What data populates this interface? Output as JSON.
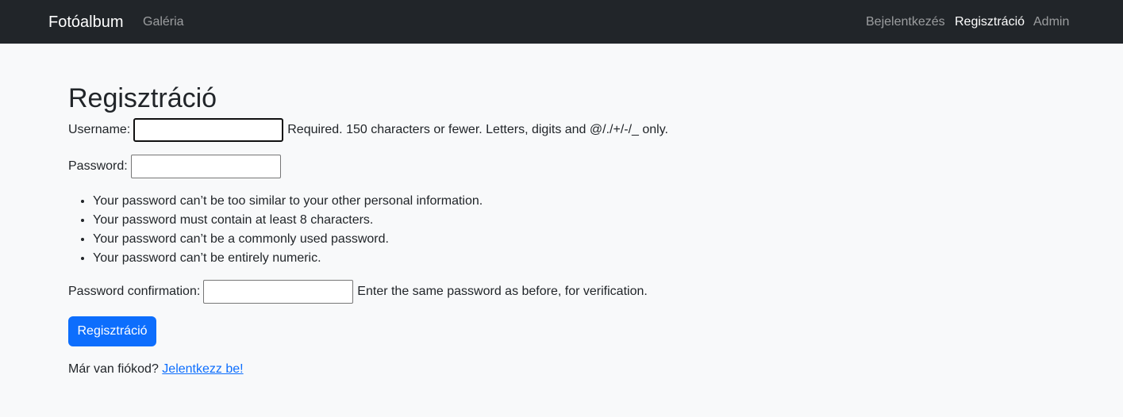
{
  "navbar": {
    "brand": "Fotóalbum",
    "left_links": [
      {
        "label": "Galéria"
      }
    ],
    "right_links": [
      {
        "label": "Bejelentkezés",
        "active": false
      },
      {
        "label": "Regisztráció",
        "active": true
      },
      {
        "label": "Admin",
        "active": false
      }
    ],
    "background_color": "#212529"
  },
  "page": {
    "title": "Regisztráció"
  },
  "form": {
    "username": {
      "label": "Username:",
      "value": "",
      "help": "Required. 150 characters or fewer. Letters, digits and @/./+/-/_ only."
    },
    "password": {
      "label": "Password:",
      "value": ""
    },
    "password_rules": [
      "Your password can’t be too similar to your other personal information.",
      "Your password must contain at least 8 characters.",
      "Your password can’t be a commonly used password.",
      "Your password can’t be entirely numeric."
    ],
    "password_confirmation": {
      "label": "Password confirmation:",
      "value": "",
      "help": "Enter the same password as before, for verification."
    },
    "submit_label": "Regisztráció",
    "submit_color": "#0d6efd"
  },
  "footer": {
    "prompt": "Már van fiókod?",
    "link_label": "Jelentkezz be!"
  }
}
